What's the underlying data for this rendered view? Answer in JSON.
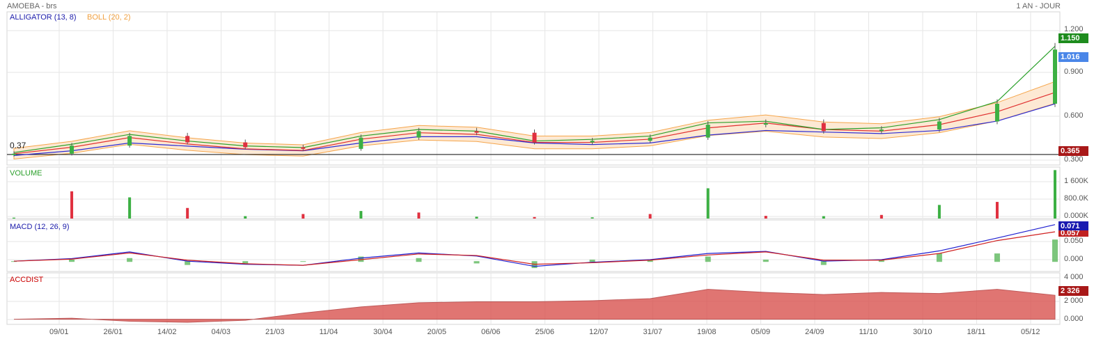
{
  "header": {
    "title": "AMOEBA - brs",
    "period": "1 AN - JOUR"
  },
  "price_panel": {
    "alligator_label": "ALLIGATOR (13, 8)",
    "boll_label": "BOLL (20, 2)",
    "support_label": "0.37",
    "y_ticks": [
      "1.200",
      "0.900",
      "0.600",
      "0.300"
    ],
    "tags": {
      "high": "1.150",
      "last": "1.016",
      "support": "0.365"
    }
  },
  "volume_panel": {
    "label": "VOLUME",
    "y_ticks": [
      "1 600K",
      "800.0K",
      "0.000K"
    ]
  },
  "macd_panel": {
    "label": "MACD (12, 26, 9)",
    "y_ticks": [
      "0.050",
      "0.000"
    ],
    "tags": {
      "macd": "0.071",
      "signal": "0.057"
    }
  },
  "accdist_panel": {
    "label": "ACCDIST",
    "y_ticks": [
      "4 000",
      "2 000",
      "0.000"
    ],
    "tags": {
      "value": "2 326"
    }
  },
  "x_axis": {
    "ticks": [
      "09/01",
      "26/01",
      "14/02",
      "04/03",
      "21/03",
      "11/04",
      "30/04",
      "20/05",
      "06/06",
      "25/06",
      "12/07",
      "31/07",
      "19/08",
      "05/09",
      "24/09",
      "11/10",
      "30/10",
      "18/11",
      "05/12"
    ]
  },
  "colors": {
    "up": "#3cb043",
    "down": "#e0303f",
    "grid": "#e6e6e6",
    "boll_fill": "#fde9d4",
    "boll_line": "#f5a54a",
    "alligator_jaw": "#2b2bd6",
    "alligator_teeth": "#e03030",
    "alligator_lips": "#2aa02a",
    "macd": "#1f1fd0",
    "signal": "#d02020",
    "histogram": "#5cb85c",
    "accdist": "#d9534f",
    "volume_label": "#2ca02c",
    "accdist_label": "#cc0000",
    "macd_label": "#1a1aaa",
    "alligator_label": "#1a1aaa",
    "boll_label": "#f0a040"
  },
  "chart_data": [
    {
      "type": "candlestick",
      "title": "AMOEBA - brs",
      "ylim": [
        0.3,
        1.25
      ],
      "support_level": 0.365,
      "x": [
        "09/01",
        "26/01",
        "14/02",
        "04/03",
        "21/03",
        "11/04",
        "30/04",
        "20/05",
        "06/06",
        "25/06",
        "12/07",
        "31/07",
        "19/08",
        "05/09",
        "24/09",
        "11/10",
        "30/10",
        "18/11",
        "05/12"
      ],
      "series": [
        {
          "name": "ALLIGATOR (13, 8)",
          "values": [
            0.37,
            0.4,
            0.45,
            0.43,
            0.41,
            0.4,
            0.45,
            0.49,
            0.49,
            0.45,
            0.44,
            0.45,
            0.5,
            0.53,
            0.52,
            0.51,
            0.53,
            0.59,
            0.7
          ]
        },
        {
          "name": "BOLL (20, 2)",
          "values": [
            0.37,
            0.41,
            0.47,
            0.43,
            0.4,
            0.39,
            0.46,
            0.5,
            0.49,
            0.44,
            0.44,
            0.46,
            0.53,
            0.56,
            0.52,
            0.51,
            0.55,
            0.63,
            0.75
          ]
        },
        {
          "name": "Close",
          "values": [
            0.37,
            0.42,
            0.48,
            0.44,
            0.41,
            0.4,
            0.47,
            0.51,
            0.5,
            0.44,
            0.45,
            0.47,
            0.55,
            0.56,
            0.51,
            0.52,
            0.57,
            0.68,
            1.016
          ]
        }
      ],
      "last": 1.016,
      "high": 1.15
    },
    {
      "type": "bar",
      "title": "VOLUME",
      "ylim": [
        0,
        1700000
      ],
      "x": [
        "09/01",
        "26/01",
        "14/02",
        "04/03",
        "21/03",
        "11/04",
        "30/04",
        "20/05",
        "06/06",
        "25/06",
        "12/07",
        "31/07",
        "19/08",
        "05/09",
        "24/09",
        "11/10",
        "30/10",
        "18/11",
        "05/12"
      ],
      "values": [
        30000,
        900000,
        700000,
        350000,
        80000,
        150000,
        250000,
        200000,
        60000,
        50000,
        40000,
        150000,
        1000000,
        90000,
        80000,
        120000,
        450000,
        550000,
        1600000
      ]
    },
    {
      "type": "line",
      "title": "MACD (12, 26, 9)",
      "ylim": [
        -0.02,
        0.08
      ],
      "x": [
        "09/01",
        "26/01",
        "14/02",
        "04/03",
        "21/03",
        "11/04",
        "30/04",
        "20/05",
        "06/06",
        "25/06",
        "12/07",
        "31/07",
        "19/08",
        "05/09",
        "24/09",
        "11/10",
        "30/10",
        "18/11",
        "05/12"
      ],
      "series": [
        {
          "name": "MACD",
          "values": [
            0.0,
            0.005,
            0.018,
            0.0,
            -0.006,
            -0.008,
            0.006,
            0.016,
            0.01,
            -0.01,
            -0.002,
            0.003,
            0.015,
            0.019,
            0.0,
            0.003,
            0.02,
            0.045,
            0.071
          ]
        },
        {
          "name": "Signal",
          "values": [
            0.0,
            0.004,
            0.016,
            0.002,
            -0.005,
            -0.008,
            0.003,
            0.014,
            0.011,
            -0.006,
            -0.003,
            0.002,
            0.012,
            0.018,
            0.002,
            0.002,
            0.015,
            0.04,
            0.057
          ]
        }
      ]
    },
    {
      "type": "area",
      "title": "ACCDIST",
      "ylim": [
        -500,
        4500
      ],
      "x": [
        "09/01",
        "26/01",
        "14/02",
        "04/03",
        "21/03",
        "11/04",
        "30/04",
        "20/05",
        "06/06",
        "25/06",
        "12/07",
        "31/07",
        "19/08",
        "05/09",
        "24/09",
        "11/10",
        "30/10",
        "18/11",
        "05/12"
      ],
      "values": [
        0,
        100,
        -200,
        -300,
        -100,
        600,
        1200,
        1600,
        1700,
        1700,
        1800,
        2000,
        2900,
        2600,
        2400,
        2600,
        2500,
        2900,
        2326
      ]
    }
  ]
}
